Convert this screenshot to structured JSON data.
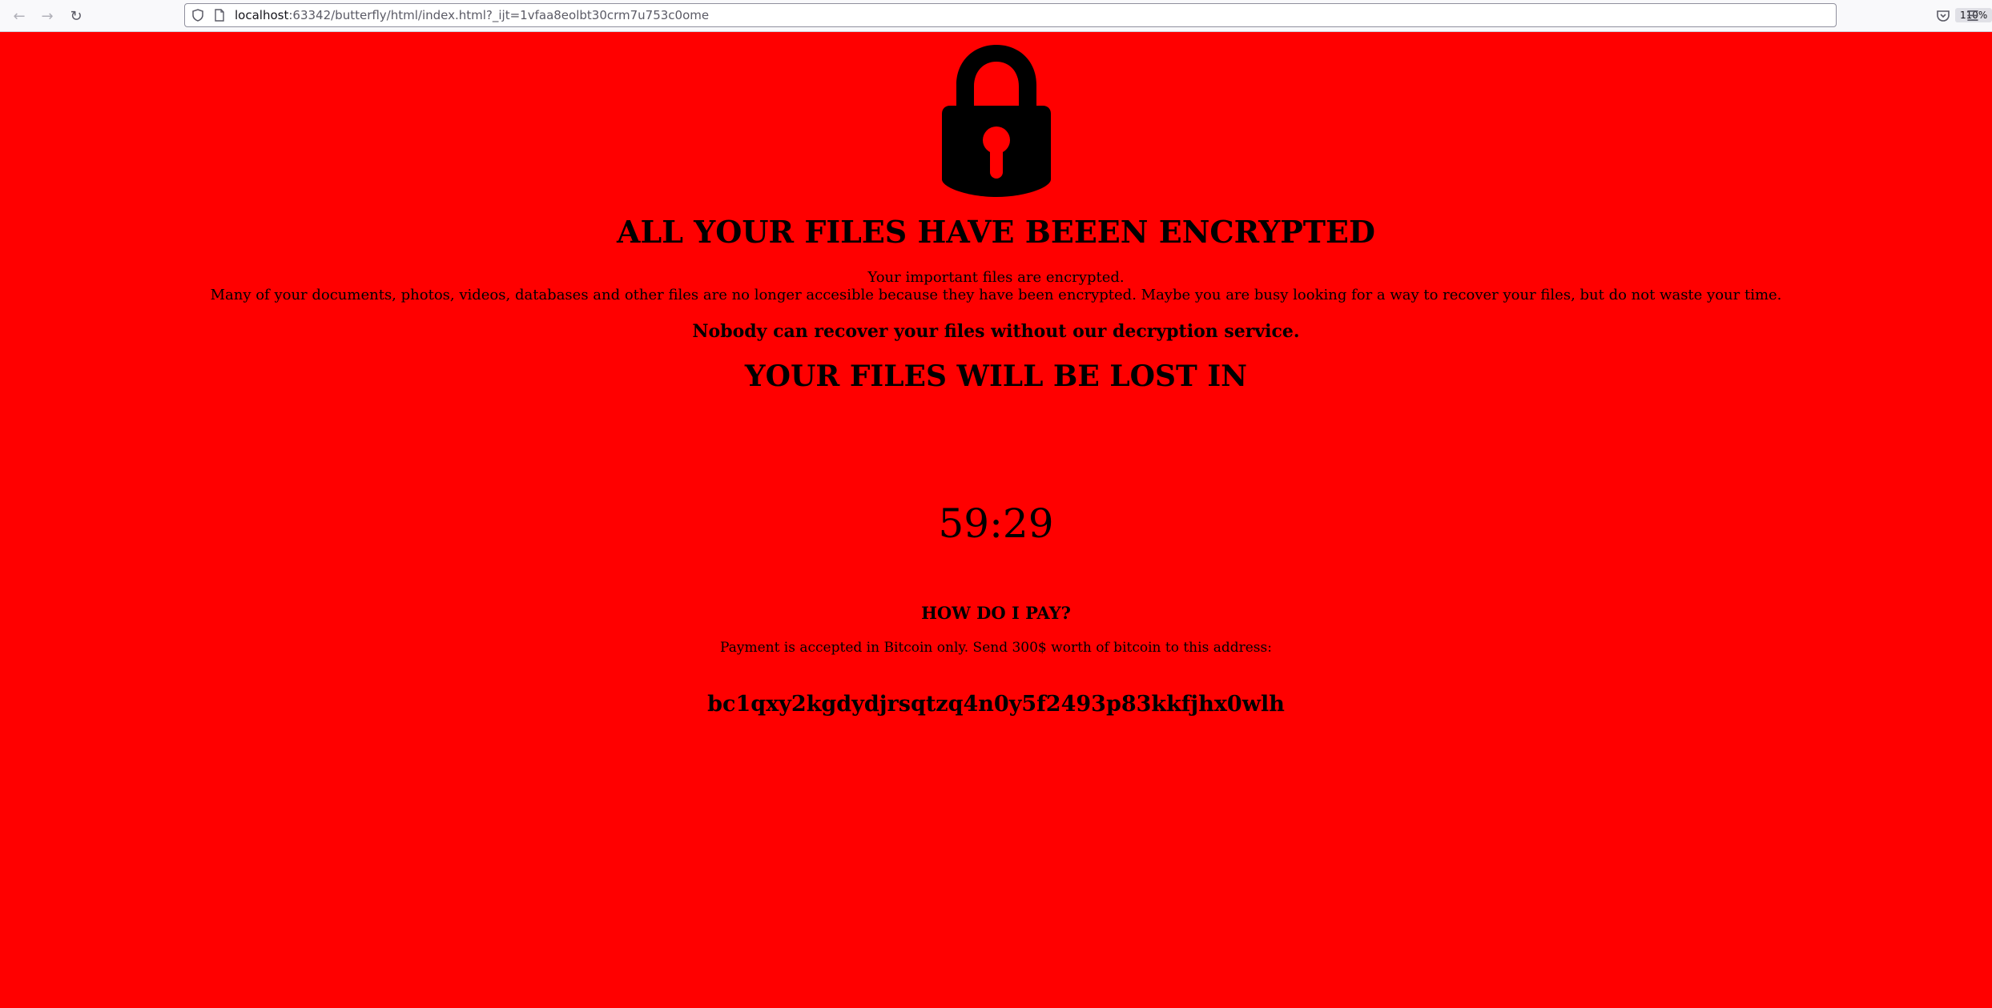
{
  "browser": {
    "url_host": "localhost",
    "url_rest": ":63342/butterfly/html/index.html?_ijt=1vfaa8eolbt30crm7u753c0ome",
    "zoom": "110%"
  },
  "page": {
    "background_color": "#ff0000",
    "headline": "ALL YOUR FILES HAVE BEEEN ENCRYPTED",
    "intro_line1": "Your important files are encrypted.",
    "intro_line2": "Many of your documents, photos, videos, databases and other files are no longer accesible because they have been encrypted. Maybe you are busy looking for a way to recover your files, but do not waste your time.",
    "nobody_text": "Nobody can recover your files without our decryption service.",
    "lost_heading": "YOUR FILES WILL BE LOST IN",
    "timer": "59:29",
    "pay_heading": "HOW DO I PAY?",
    "pay_text": "Payment is accepted in Bitcoin only. Send 300$ worth of bitcoin to this address:",
    "btc_address": "bc1qxy2kgdydjrsqtzq4n0y5f2493p83kkfjhx0wlh"
  },
  "icons": {
    "lock": "padlock-icon",
    "back": "arrow-left-icon",
    "forward": "arrow-right-icon",
    "reload": "reload-icon",
    "shield": "shield-icon",
    "page": "page-icon",
    "bookmark": "star-icon",
    "pocket": "pocket-icon",
    "menu": "hamburger-menu-icon"
  }
}
